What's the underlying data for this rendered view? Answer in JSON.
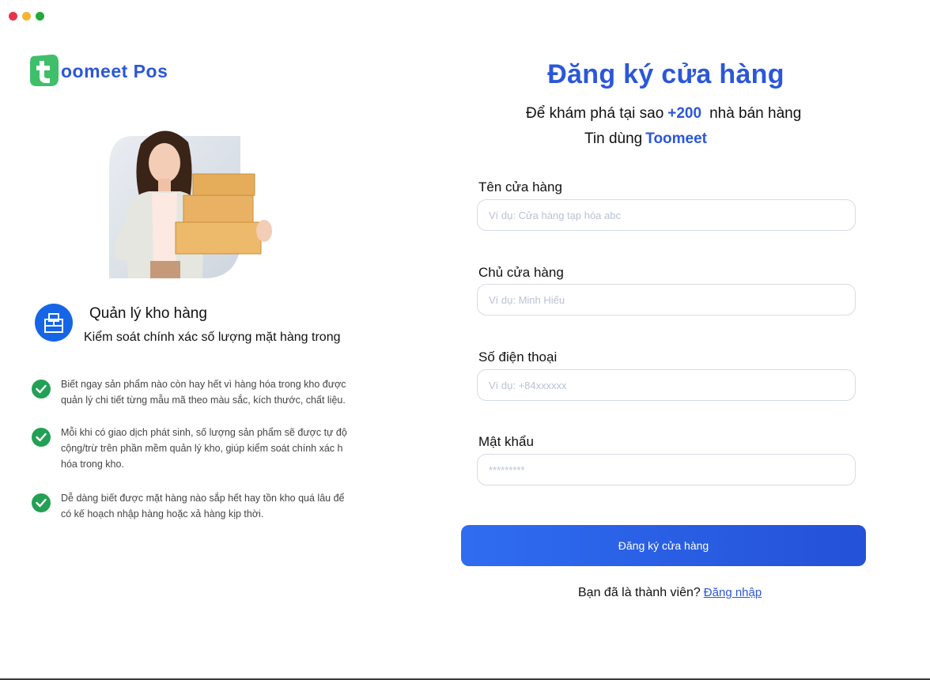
{
  "window": {
    "dots": [
      "#e8344b",
      "#f2b632",
      "#22a93a"
    ]
  },
  "brand": {
    "name": "oomeet Pos",
    "logo_letter": "t",
    "color": "#2b57d9",
    "logo_color": "#3fbf6a"
  },
  "hero": {
    "icon": "woman-holding-boxes-image"
  },
  "feature": {
    "icon": "warehouse-box-icon",
    "title": "Quản lý kho hàng",
    "subtitle": "Kiểm soát chính xác số lượng mặt hàng trong"
  },
  "bullets": [
    {
      "lines": [
        "Biết ngay sản phẩm nào còn hay hết vì hàng hóa trong kho được",
        "quản lý chi tiết từng mẫu mã theo màu sắc, kích thước, chất liệu."
      ]
    },
    {
      "lines": [
        "Mỗi khi có giao dịch phát sinh, số lượng sản phẩm sẽ được tự độ",
        "cộng/trừ trên phần mềm quản lý kho, giúp kiểm soát chính xác h",
        "hóa trong kho."
      ]
    },
    {
      "lines": [
        "Dễ dàng biết được mặt hàng nào sắp hết hay tồn kho quá lâu để",
        "có kế hoạch nhập hàng hoặc xả hàng kịp thời."
      ]
    }
  ],
  "form": {
    "title": "Đăng ký cửa hàng",
    "subtitle_prefix": "Để khám phá tại sao",
    "subtitle_count": "+200",
    "subtitle_suffix": "nhà bán hàng",
    "subtitle2_prefix": "Tin dùng",
    "subtitle2_brand": "Toomeet",
    "fields": [
      {
        "label": "Tên cửa hàng",
        "placeholder": "Ví dụ: Cửa hàng tạp hóa abc",
        "value": ""
      },
      {
        "label": "Chủ cửa hàng",
        "placeholder": "Ví dụ: Minh Hiếu",
        "value": ""
      },
      {
        "label": "Số điện thoại",
        "placeholder": "Ví dụ: +84xxxxxx",
        "value": ""
      },
      {
        "label": "Mật khẩu",
        "placeholder": "*********",
        "value": ""
      }
    ],
    "submit_label": "Đăng ký cửa hàng",
    "member_prompt": "Bạn đã là thành viên?",
    "login_link": "Đăng nhập",
    "accent": "#2b57d9"
  }
}
